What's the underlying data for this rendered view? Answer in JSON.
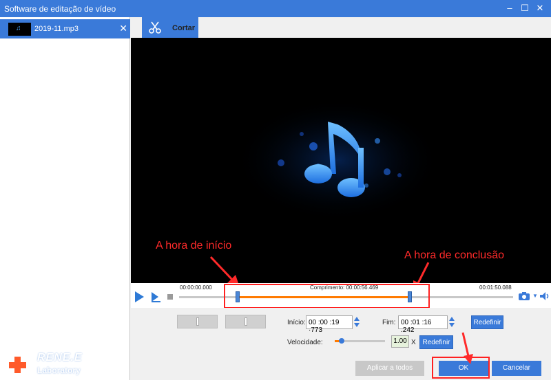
{
  "window": {
    "title": "Software de editação de vídeo",
    "minimize_icon": "minimize-icon",
    "maximize_icon": "maximize-icon",
    "close_icon": "close-icon"
  },
  "file_list": {
    "items": [
      {
        "name": "2019-11.mp3",
        "thumbnail_icon": "music-note-icon",
        "remove_icon": "close-icon"
      }
    ]
  },
  "tabs": [
    {
      "label": "Cortar",
      "icon": "scissors-icon",
      "active": true
    }
  ],
  "annotations": {
    "start_label": "A hora de início",
    "end_label": "A hora de conclusão"
  },
  "timeline": {
    "start_time": "00:00:00.000",
    "length_text": "Comprimento: 00:00:56.469",
    "end_time": "00:01:50.088",
    "selection_start_fraction": 0.176,
    "selection_end_fraction": 0.69
  },
  "trim": {
    "start_label": "Início:",
    "start_value": "00 :00 :19 ·773",
    "end_label": "Fim:",
    "end_value": "00 :01 :16 .242",
    "reset_label": "Redefinir"
  },
  "speed": {
    "label": "Velocidade:",
    "value": "1.00",
    "unit": "X",
    "reset_label": "Redefinir",
    "level_fraction": 0.14
  },
  "buttons": {
    "apply_all": "Aplicar a todos",
    "ok": "OK",
    "cancel": "Cancelar"
  },
  "logo": {
    "name": "RENE.E",
    "sub": "Laboratory"
  },
  "colors": {
    "accent": "#3a7ad9",
    "selection": "#ff7a00",
    "annotation": "#ff2a2a"
  }
}
